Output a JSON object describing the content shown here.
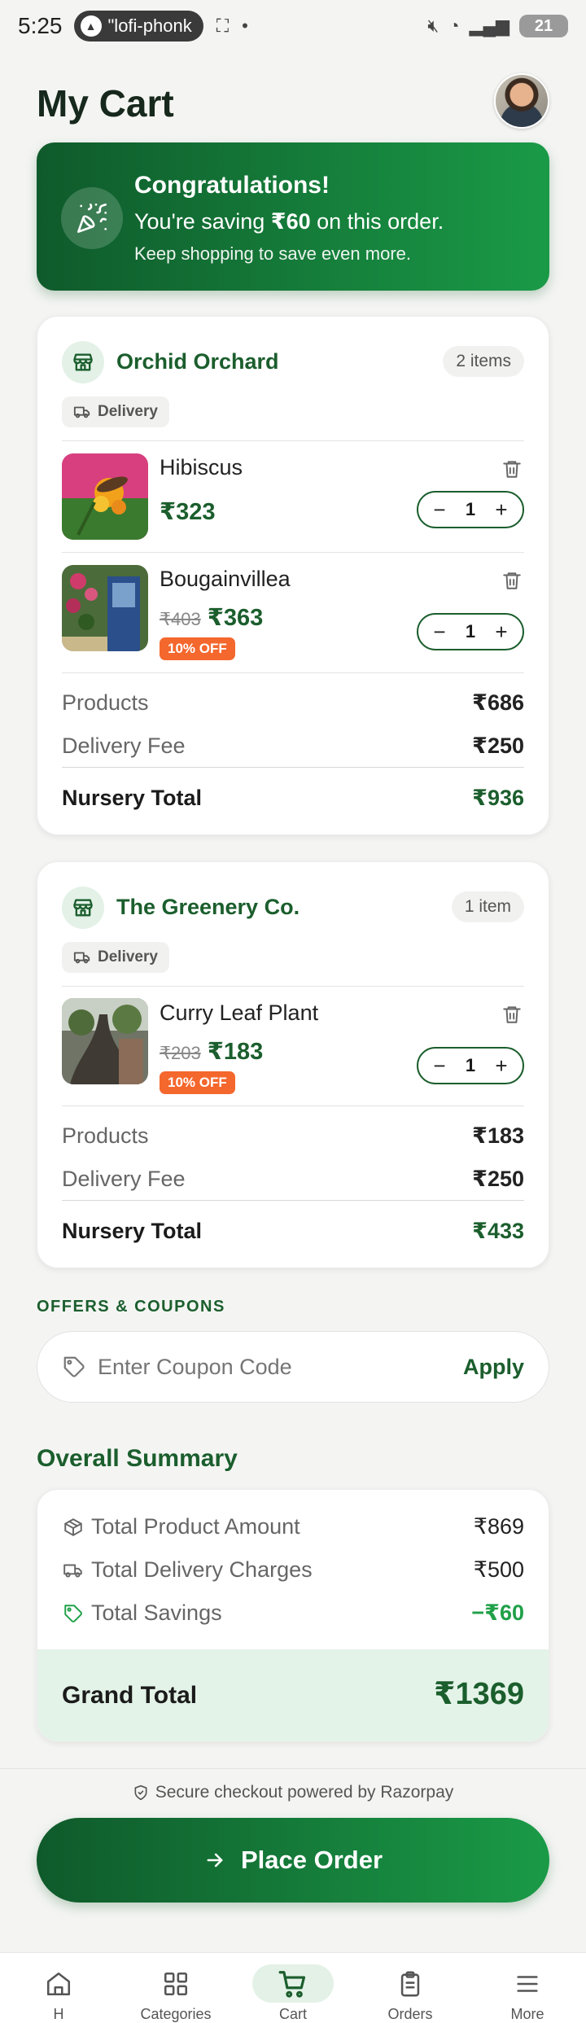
{
  "status_bar": {
    "time": "5:25",
    "pill_text": "\"lofi-phonk",
    "battery": "21"
  },
  "header": {
    "title": "My Cart"
  },
  "banner": {
    "title": "Congratulations!",
    "saving_prefix": "You're saving ",
    "saving_amount": "₹60",
    "saving_suffix": " on this order.",
    "subtitle": "Keep shopping to save even more."
  },
  "nurseries": [
    {
      "name": "Orchid Orchard",
      "count": "2 items",
      "delivery_tag": "Delivery",
      "items": [
        {
          "name": "Hibiscus",
          "price": "₹323",
          "old_price": "",
          "discount": "",
          "qty": "1"
        },
        {
          "name": "Bougainvillea",
          "price": "₹363",
          "old_price": "₹403",
          "discount": "10% OFF",
          "qty": "1"
        }
      ],
      "products_label": "Products",
      "products_value": "₹686",
      "delivery_label": "Delivery Fee",
      "delivery_value": "₹250",
      "total_label": "Nursery Total",
      "total_value": "₹936"
    },
    {
      "name": "The Greenery Co.",
      "count": "1 item",
      "delivery_tag": "Delivery",
      "items": [
        {
          "name": "Curry Leaf Plant",
          "price": "₹183",
          "old_price": "₹203",
          "discount": "10% OFF",
          "qty": "1"
        }
      ],
      "products_label": "Products",
      "products_value": "₹183",
      "delivery_label": "Delivery Fee",
      "delivery_value": "₹250",
      "total_label": "Nursery Total",
      "total_value": "₹433"
    }
  ],
  "coupons": {
    "section_label": "OFFERS & COUPONS",
    "placeholder": "Enter Coupon Code",
    "apply_label": "Apply"
  },
  "summary": {
    "title": "Overall Summary",
    "product_label": "Total Product Amount",
    "product_value": "₹869",
    "delivery_label": "Total Delivery Charges",
    "delivery_value": "₹500",
    "savings_label": "Total Savings",
    "savings_value": "−₹60",
    "grand_label": "Grand Total",
    "grand_value": "₹1369"
  },
  "checkout": {
    "secure_text": "Secure checkout powered by Razorpay",
    "place_order_label": "Place Order"
  },
  "colors": {
    "brand_green": "#1b5e2d",
    "accent_green": "#1a9a47",
    "discount_orange": "#f4672d"
  },
  "bottom_nav": [
    {
      "icon": "home-icon",
      "label": "H",
      "active": false
    },
    {
      "icon": "grid-icon",
      "label": "Categories",
      "active": false
    },
    {
      "icon": "cart-icon",
      "label": "Cart",
      "active": true
    },
    {
      "icon": "clipboard-icon",
      "label": "Orders",
      "active": false
    },
    {
      "icon": "menu-icon",
      "label": "More",
      "active": false
    }
  ]
}
